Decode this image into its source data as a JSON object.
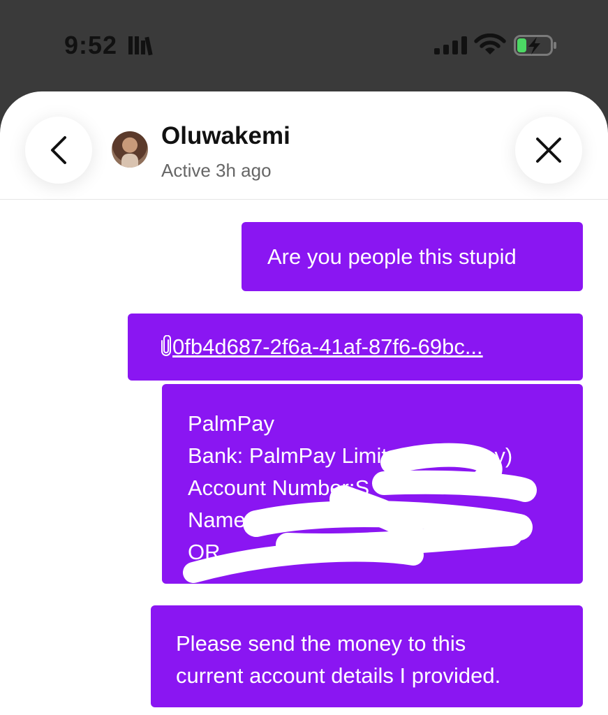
{
  "status_bar": {
    "time": "9:52",
    "icons": [
      "library-icon",
      "cellular-signal-icon",
      "wifi-icon",
      "battery-charging-icon"
    ]
  },
  "header": {
    "back_icon": "chevron-left-icon",
    "close_icon": "close-icon",
    "contact_name": "Oluwakemi",
    "presence": "Active 3h ago"
  },
  "messages": [
    {
      "text": "Are you people this stupid"
    },
    {
      "attachment_icon": "paperclip-icon",
      "attachment_label": "0fb4d687-2f6a-41af-87f6-69bc..."
    },
    {
      "lines": [
        "PalmPay",
        "Bank: PalmPay Limited(PalmPay)",
        "Account Number:S",
        "Name:CH",
        "OR"
      ],
      "redacted": true
    },
    {
      "lines": [
        "Please send the money to this",
        "current account details I provided."
      ]
    }
  ],
  "colors": {
    "bubble": "#8a16f2",
    "status_bar_bg": "#3a3a3a",
    "battery_green": "#4cd964"
  }
}
